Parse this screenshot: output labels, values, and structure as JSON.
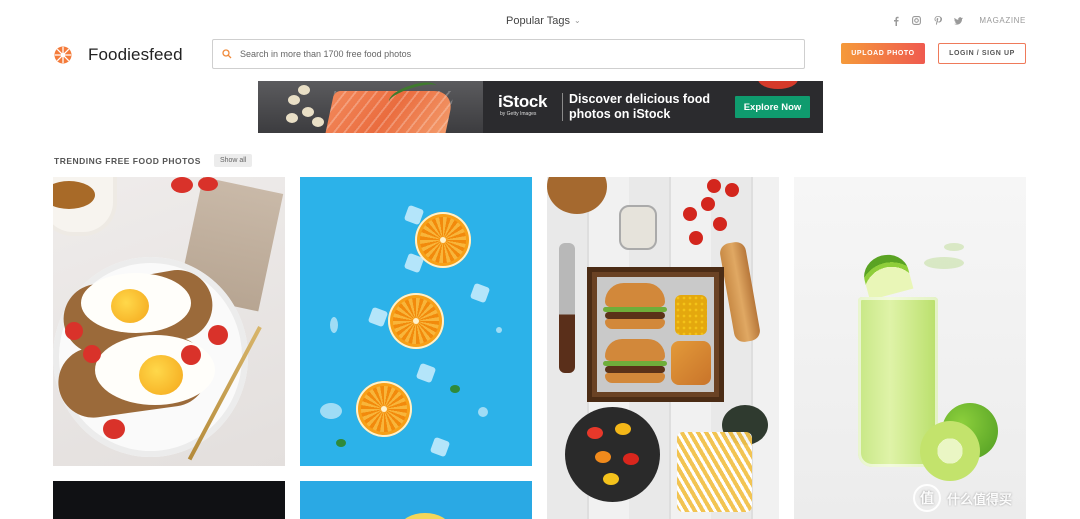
{
  "topbar": {
    "popular_tags_label": "Popular Tags",
    "socials": [
      "facebook-icon",
      "instagram-icon",
      "pinterest-icon",
      "twitter-icon"
    ],
    "magazine_label": "MAGAZINE"
  },
  "header": {
    "logo_text": "Foodiesfeed",
    "search_placeholder": "Search in more than 1700 free food photos",
    "upload_label": "UPLOAD PHOTO",
    "login_label": "LOGIN / SIGN UP"
  },
  "ad": {
    "brand": "iStock",
    "brand_sub": "by Getty Images",
    "headline": "Discover delicious food photos on iStock",
    "cta_label": "Explore Now"
  },
  "section": {
    "title": "TRENDING FREE FOOD PHOTOS",
    "show_all_label": "Show all"
  },
  "photos": [
    "eggs-toast-photo",
    "orange-slices-photo",
    "burger-tray-photo",
    "lime-juice-photo",
    "dark-photo",
    "blue-photo"
  ],
  "watermark": {
    "glyph": "值",
    "text": "什么值得买"
  },
  "colors": {
    "accent_orange": "#f59a3a",
    "accent_red": "#ef5a4f",
    "cta_green": "#0f9b6e"
  }
}
